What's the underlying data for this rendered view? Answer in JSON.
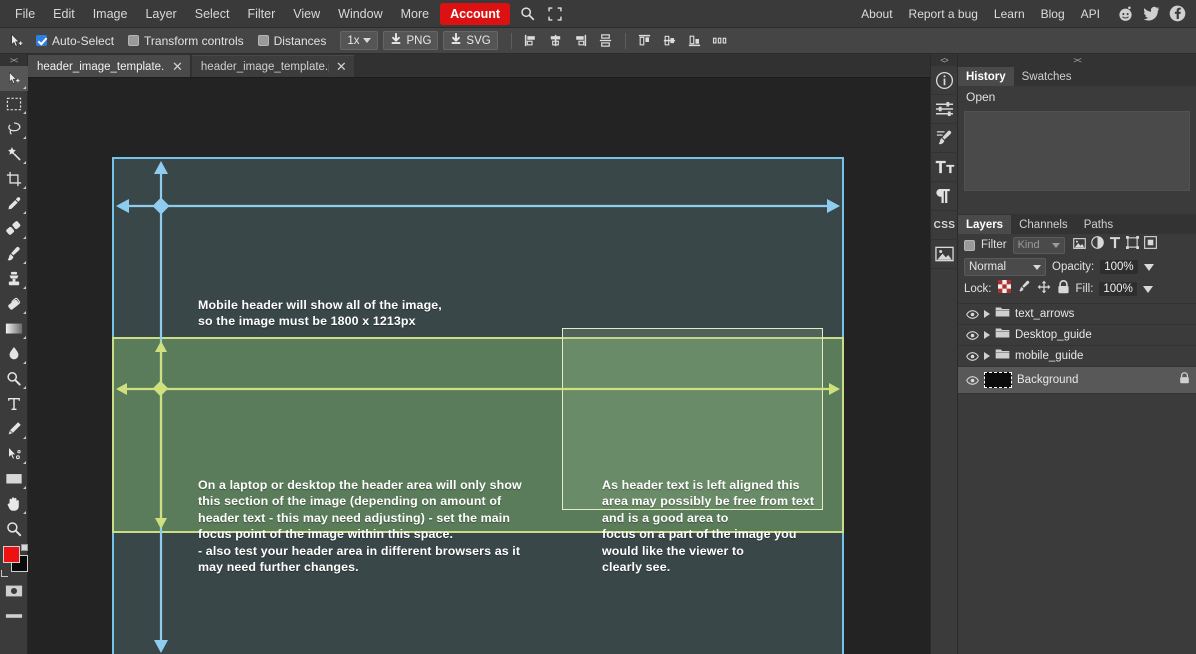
{
  "app": {
    "name": "Photopea",
    "accent_red": "#dd1111",
    "canvas_bg": "#232323"
  },
  "menubar": {
    "items": [
      "File",
      "Edit",
      "Image",
      "Layer",
      "Select",
      "Filter",
      "View",
      "Window",
      "More"
    ],
    "account_label": "Account",
    "search_icon": "search-icon",
    "fullscreen_icon": "fullscreen-icon",
    "right_items": [
      "About",
      "Report a bug",
      "Learn",
      "Blog",
      "API"
    ],
    "social_icons": [
      "reddit-icon",
      "twitter-icon",
      "facebook-icon"
    ]
  },
  "optionsbar": {
    "tool_icon": "move-tool-icon",
    "auto_select_label": "Auto-Select",
    "auto_select_checked": true,
    "transform_controls_label": "Transform controls",
    "transform_controls_checked": false,
    "distances_label": "Distances",
    "distances_checked": false,
    "zoom_value": "1x",
    "png_label": "PNG",
    "svg_label": "SVG",
    "align_icons": [
      "align-left-icon",
      "align-center-horizontal-icon",
      "align-right-icon",
      "distribute-vertical-icon",
      "align-top-icon",
      "align-middle-vertical-icon",
      "align-bottom-icon",
      "distribute-horizontal-icon"
    ]
  },
  "tabs": [
    {
      "title": "header_image_template.p",
      "active": false,
      "close_icon": "close-icon"
    },
    {
      "title": "header_image_template.p",
      "active": true,
      "close_icon": "close-icon"
    }
  ],
  "toolbar": {
    "collapse_glyph": "><",
    "tools": [
      {
        "name": "move-tool",
        "active": true
      },
      {
        "name": "rectangular-marquee-tool",
        "active": false
      },
      {
        "name": "lasso-tool",
        "active": false
      },
      {
        "name": "magic-wand-tool",
        "active": false
      },
      {
        "name": "crop-tool",
        "active": false
      },
      {
        "name": "eyedropper-tool",
        "active": false
      },
      {
        "name": "patch-tool",
        "active": false
      },
      {
        "name": "brush-tool",
        "active": false
      },
      {
        "name": "clone-stamp-tool",
        "active": false
      },
      {
        "name": "eraser-tool",
        "active": false
      },
      {
        "name": "gradient-tool",
        "active": false
      },
      {
        "name": "blur-tool",
        "active": false
      },
      {
        "name": "dodge-tool",
        "active": false
      },
      {
        "name": "type-tool",
        "active": false
      },
      {
        "name": "pen-tool",
        "active": false
      },
      {
        "name": "path-select-tool",
        "active": false
      },
      {
        "name": "shape-tool",
        "active": false
      },
      {
        "name": "hand-tool",
        "active": false
      },
      {
        "name": "zoom-tool",
        "active": false
      }
    ],
    "foreground_color": "#ee1111",
    "background_color": "#0a0a0a",
    "screen_mode_icon": "screen-mode-icon",
    "quick_mask_icon": "quick-mask-icon"
  },
  "canvas": {
    "mobile_fill": "#3a4748",
    "mobile_border": "#77c2e8",
    "desktop_fill": "#5b7c5a",
    "desktop_border": "#ccdd88",
    "focus_border": "#e3eec0",
    "mobile_note": "Mobile header will show all of the image,\nso the image must be 1800 x 1213px",
    "desktop_note": "On a laptop or desktop the header area will only show\nthis section of the image (depending on amount of\nheader text - this may need adjusting) - set the main\nfocus point of the image within this space.\n- also test your header area in different browsers as it\nmay need further changes.",
    "focus_note": "As header text is left aligned this\narea may possibly be free from text\nand is a good area to\nfocus on a part of the image you\nwould like the viewer to\nclearly see."
  },
  "rail": {
    "collapse_glyph": "<>",
    "buttons": [
      "info-icon",
      "adjustments-icon",
      "brush-presets-icon",
      "character-icon",
      "paragraph-icon",
      "css-icon",
      "navigator-image-icon"
    ],
    "css_label": "CSS"
  },
  "panels": {
    "collapse_glyph": "><",
    "top": {
      "tabs": [
        {
          "label": "History",
          "active": true
        },
        {
          "label": "Swatches",
          "active": false
        }
      ],
      "history_items": [
        "Open"
      ]
    },
    "layers": {
      "tabs": [
        {
          "label": "Layers",
          "active": true
        },
        {
          "label": "Channels",
          "active": false
        },
        {
          "label": "Paths",
          "active": false
        }
      ],
      "filter_label": "Filter",
      "filter_checked": false,
      "kind_label": "Kind",
      "filter_icons": [
        "image-filter-icon",
        "adjustment-filter-icon",
        "type-filter-icon",
        "shape-filter-icon",
        "smart-object-filter-icon"
      ],
      "blend_mode": "Normal",
      "opacity_label": "Opacity:",
      "opacity_value": "100%",
      "lock_label": "Lock:",
      "lock_icons": [
        "lock-transparency-icon",
        "lock-pixels-icon",
        "lock-position-icon",
        "lock-all-icon"
      ],
      "fill_label": "Fill:",
      "fill_value": "100%",
      "rows": [
        {
          "name": "text_arrows",
          "visible": true,
          "group": true,
          "selected": false,
          "locked": false
        },
        {
          "name": "Desktop_guide",
          "visible": true,
          "group": true,
          "selected": false,
          "locked": false
        },
        {
          "name": "mobile_guide",
          "visible": true,
          "group": true,
          "selected": false,
          "locked": false
        },
        {
          "name": "Background",
          "visible": true,
          "group": false,
          "selected": true,
          "locked": true
        }
      ]
    }
  }
}
